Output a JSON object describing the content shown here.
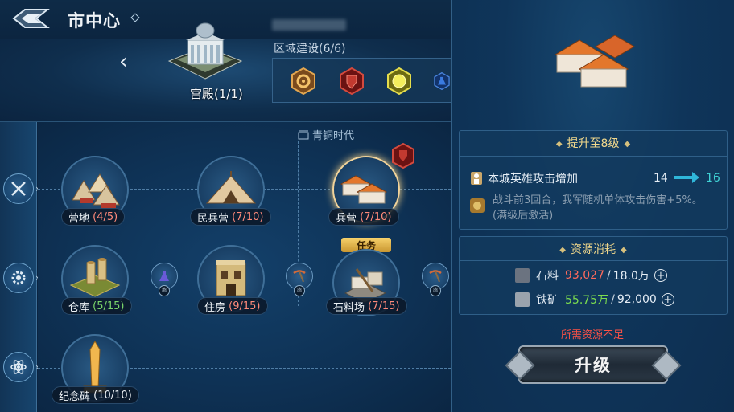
{
  "header": {
    "title": "市中心",
    "palace_label": "宫殿(1/1)",
    "region_title": "区域建设(6/6)"
  },
  "tree": {
    "era_label": "青铜时代",
    "task_tag": "任务",
    "nodes": [
      {
        "name": "营地",
        "count": "(4/5)",
        "count_color": "red"
      },
      {
        "name": "民兵营",
        "count": "(7/10)",
        "count_color": "red"
      },
      {
        "name": "兵营",
        "count": "(7/10)",
        "count_color": "red"
      },
      {
        "name": "仓库",
        "count": "(5/15)",
        "count_color": "green"
      },
      {
        "name": "住房",
        "count": "(9/15)",
        "count_color": "red"
      },
      {
        "name": "石料场",
        "count": "(7/15)",
        "count_color": "red"
      },
      {
        "name": "纪念碑",
        "count": "(10/10)",
        "count_color": "white"
      }
    ]
  },
  "panel": {
    "upgrade_title": "提升至8级",
    "effect_name": "本城英雄攻击增加",
    "effect_from": "14",
    "effect_to": "16",
    "effect_desc": "战斗前3回合，我军随机单体攻击伤害+5%。(满级后激活)",
    "resource_title": "资源消耗",
    "resources": [
      {
        "name": "石料",
        "have": "93,027",
        "need": "18.0万",
        "have_color": "#ff6a5c"
      },
      {
        "name": "铁矿",
        "have": "55.75万",
        "need": "92,000",
        "have_color": "#7bdc4f"
      }
    ],
    "warning": "所需资源不足",
    "upgrade_button": "升级"
  },
  "colors": {
    "accent_gold": "#f2d98c",
    "cyan": "#40d4d6",
    "red": "#ff6a5c",
    "green": "#7bdc4f"
  },
  "icons": [
    "back-icon",
    "chevron-left-icon",
    "sword-icon",
    "gear-icon",
    "atom-icon",
    "shield-icon"
  ]
}
